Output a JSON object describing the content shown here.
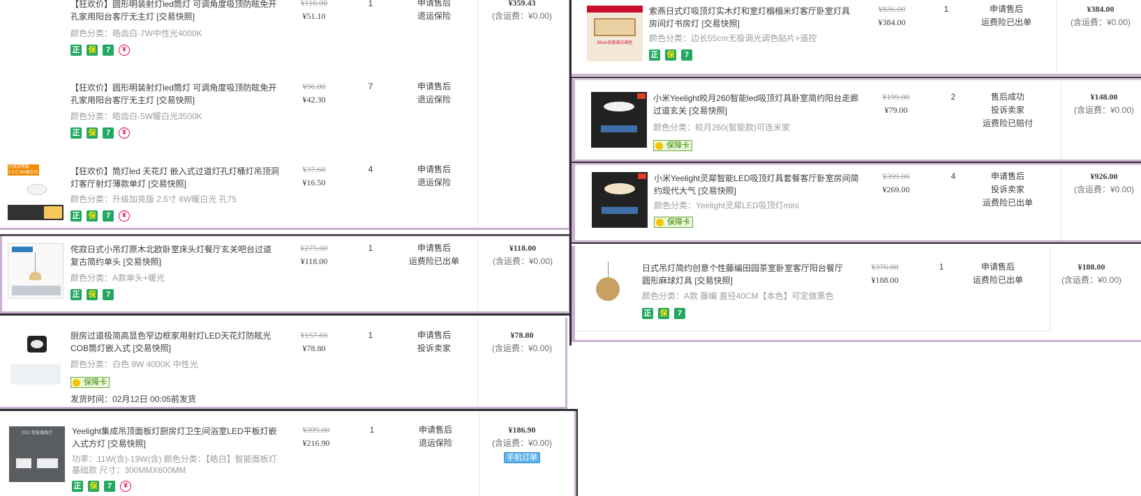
{
  "left_order_a": {
    "total": "¥359.43",
    "shipping": "(含运费：¥0.00)",
    "items": [
      {
        "title": "【狂欢价】圆形明装射灯led筒灯 可调角度吸顶防眩免开孔家用阳台客厅无主灯 [交易快照]",
        "sku": "颜色分类：皓齿白-7W中性光4000K",
        "price_old": "¥116.00",
        "price_new": "¥51.10",
        "qty": "1",
        "after_sale": [
          "申请售后",
          "退运保险"
        ]
      },
      {
        "title": "【狂欢价】圆形明装射灯led筒灯 可调角度吸顶防眩免开孔家用阳台客厅无主灯 [交易快照]",
        "sku": "颜色分类：皓齿白-5W暖白光3500K",
        "price_old": "¥96.00",
        "price_new": "¥42.30",
        "qty": "7",
        "after_sale": [
          "申请售后",
          "退运保险"
        ]
      },
      {
        "title": "【狂欢价】筒灯led 天花灯 嵌入式过道灯孔灯桶灯吊顶洞灯客厅射灯薄款单灯 [交易快照]",
        "sku": "颜色分类：升级加亮版 2.5寸 6W暖白光 孔75",
        "price_old": "¥37.60",
        "price_new": "¥16.50",
        "qty": "4",
        "after_sale": [
          "申请售后",
          "退运保险"
        ],
        "img_text": [
          "升级加亮版",
          "2.5寸 6W暖白光"
        ]
      }
    ]
  },
  "left_order_b": {
    "title": "侘寂日式小吊灯原木北欧卧室床头灯餐厅玄关吧台过道复古简约单头 [交易快照]",
    "sku": "颜色分类：A款单头+暖光",
    "price_old": "¥275.00",
    "price_new": "¥118.00",
    "qty": "1",
    "after_sale": [
      "申请售后",
      "运费险已出单"
    ],
    "total": "¥118.00",
    "shipping": "(含运费：¥0.00)"
  },
  "left_order_c": {
    "title": "厨房过道极简高显色窄边框家用射灯LED天花灯防眩光COB筒灯嵌入式 [交易快照]",
    "sku": "颜色分类：白色 9W 4000K 中性光",
    "card": "保障卡",
    "ship_time": "发货时间：02月12日 00:05前发货",
    "price_old": "¥157.60",
    "price_new": "¥78.80",
    "qty": "1",
    "after_sale": [
      "申请售后",
      "投诉卖家"
    ],
    "total": "¥78.80",
    "shipping": "(含运费：¥0.00)"
  },
  "left_order_d": {
    "title": "Yeelight集成吊顶面板灯厨房灯卫生间浴室LED平板灯嵌入式方灯 [交易快照]",
    "sku": "功率：11W(含)-19W(含)   颜色分类：【皓白】智能面板灯基础款   尺寸：300MMX600MM",
    "price_old": "¥399.00",
    "price_new": "¥216.90",
    "qty": "1",
    "after_sale": [
      "申请售后",
      "退运保险"
    ],
    "total": "¥186.90",
    "shipping": "(含运费：¥0.00)",
    "mobile_tag": "手机订单",
    "img_text": "2022 智能面板灯"
  },
  "right_order_a": {
    "title": "索燕日式灯吸顶灯实木灯和室灯榻榻米灯客厅卧室灯具房间灯书房灯 [交易快照]",
    "sku": "颜色分类：边长55cm无极调光调色贴片+遥控",
    "price_old": "¥836.00",
    "price_new": "¥384.00",
    "qty": "1",
    "after_sale": [
      "申请售后",
      "运费险已出单"
    ],
    "total": "¥384.00",
    "shipping": "(含运费：¥0.00)",
    "img_text": "55cm无极调光调色"
  },
  "right_order_b": {
    "title": "小米Yeelight皎月260智能led吸顶灯具卧室简约阳台走廊过道玄关 [交易快照]",
    "sku": "颜色分类：皎月260(智能款)可连米家",
    "card": "保障卡",
    "price_old": "¥199.00",
    "price_new": "¥79.00",
    "qty": "2",
    "after_sale": [
      "售后成功",
      "投诉卖家",
      "运费险已赔付"
    ],
    "total": "¥148.00",
    "shipping": "(含运费：¥0.00)"
  },
  "right_order_c": {
    "title": "小米Yeelight灵犀智能LED吸顶灯具套餐客厅卧室房间简约现代大气 [交易快照]",
    "sku": "颜色分类：Yeelight灵犀LED吸顶灯mini",
    "card": "保障卡",
    "price_old": "¥399.00",
    "price_new": "¥269.00",
    "qty": "4",
    "after_sale": [
      "申请售后",
      "投诉卖家",
      "运费险已出单"
    ],
    "total": "¥926.00",
    "shipping": "(含运费：¥0.00)"
  },
  "right_order_d": {
    "title": "日式吊灯简约创意个性藤编田园茶室卧室客厅阳台餐厅圆形麻球灯具 [交易快照]",
    "sku": "颜色分类：A款 藤编 直径40CM【本色】可定做黑色",
    "price_old": "¥376.00",
    "price_new": "¥188.00",
    "qty": "1",
    "after_sale": [
      "申请售后",
      "运费险已出单"
    ],
    "total": "¥188.00",
    "shipping": "(含运费：¥0.00)"
  },
  "badges": {
    "zheng": "正",
    "bao": "保",
    "seven": "7",
    "yuan": "¥"
  },
  "colors": {
    "frame": "#c9b0cf",
    "dark_border": "#2a2a2a",
    "link_text": "#3c3c3c"
  }
}
